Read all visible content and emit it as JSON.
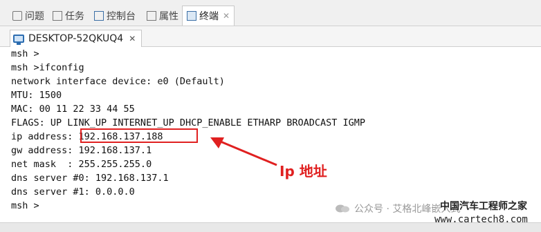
{
  "tabs": [
    {
      "label": "问题",
      "icon": "problems-icon"
    },
    {
      "label": "任务",
      "icon": "tasks-icon"
    },
    {
      "label": "控制台",
      "icon": "console-icon"
    },
    {
      "label": "属性",
      "icon": "properties-icon"
    },
    {
      "label": "终端",
      "icon": "terminal-icon",
      "active": true
    }
  ],
  "session": {
    "name": "DESKTOP-52QKUQ4",
    "icon": "monitor-icon"
  },
  "terminal_lines": [
    "msh >",
    "msh >ifconfig",
    "network interface device: e0 (Default)",
    "MTU: 1500",
    "MAC: 00 11 22 33 44 55",
    "FLAGS: UP LINK_UP INTERNET_UP DHCP_ENABLE ETHARP BROADCAST IGMP",
    "ip address: 192.168.137.188",
    "gw address: 192.168.137.1",
    "net mask  : 255.255.255.0",
    "dns server #0: 192.168.137.1",
    "dns server #1: 0.0.0.0",
    "msh >"
  ],
  "annotation": {
    "label": "Ip 地址",
    "color": "#e02020"
  },
  "watermark": {
    "text": "公众号 · 艾格北峰嵌入式",
    "brand": "中国汽车工程师之家",
    "url": "www.cartech8.com"
  }
}
